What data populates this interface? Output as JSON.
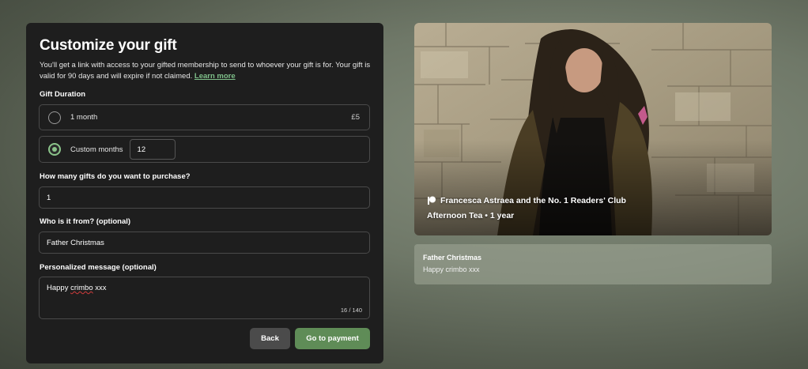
{
  "form": {
    "title": "Customize your gift",
    "description": "You'll get a link with access to your gifted membership to send to whoever your gift is for. Your gift is valid for 90 days and will expire if not claimed.",
    "learn_more": "Learn more",
    "duration_label": "Gift Duration",
    "option_month": {
      "label": "1 month",
      "price": "£5"
    },
    "option_custom": {
      "label": "Custom months",
      "value": "12"
    },
    "quantity_label": "How many gifts do you want to purchase?",
    "quantity_value": "1",
    "from_label": "Who is it from? (optional)",
    "from_value": "Father Christmas",
    "message_label": "Personalized message (optional)",
    "message_word1": "Happy ",
    "message_word2": "crimbo",
    "message_word3": " xxx",
    "message_counter": "16 / 140",
    "back_button": "Back",
    "pay_button": "Go to payment"
  },
  "preview": {
    "creator": "Francesca Astraea and the No. 1 Readers' Club",
    "tier": "Afternoon Tea • 1 year",
    "from": "Father Christmas",
    "message": "Happy crimbo xxx"
  },
  "colors": {
    "accent_green": "#5f8c57",
    "radio_green": "#8bc48a",
    "link_green": "#7fc08a"
  }
}
